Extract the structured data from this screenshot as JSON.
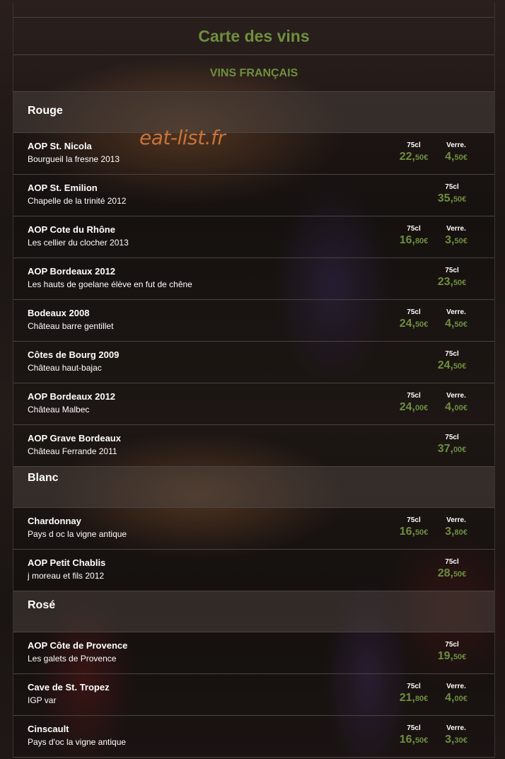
{
  "header": {
    "title": "Carte des vins",
    "subtitle": "VINS FRANÇAIS"
  },
  "watermark": "eat-list.fr",
  "labels": {
    "bottle": "75cl",
    "glass": "Verre."
  },
  "sections": [
    {
      "name": "Rouge",
      "wines": [
        {
          "name": "AOP St. Nicola",
          "desc": "Bourgueil la fresne 2013",
          "bottle_int": "22,",
          "bottle_cents": "50€",
          "glass_int": "4,",
          "glass_cents": "50€"
        },
        {
          "name": "AOP St. Emilion",
          "desc": "Chapelle de la trinité 2012",
          "bottle_int": "35,",
          "bottle_cents": "50€"
        },
        {
          "name": "AOP Cote du Rhône",
          "desc": "Les cellier du clocher 2013",
          "bottle_int": "16,",
          "bottle_cents": "80€",
          "glass_int": "3,",
          "glass_cents": "50€"
        },
        {
          "name": "AOP Bordeaux 2012",
          "desc": "Les hauts de goelane élève en fut de chêne",
          "bottle_int": "23,",
          "bottle_cents": "50€"
        },
        {
          "name": "Bodeaux 2008",
          "desc": "Château barre gentillet",
          "bottle_int": "24,",
          "bottle_cents": "50€",
          "glass_int": "4,",
          "glass_cents": "50€"
        },
        {
          "name": "Côtes de Bourg 2009",
          "desc": "Château haut-bajac",
          "bottle_int": "24,",
          "bottle_cents": "50€"
        },
        {
          "name": "AOP Bordeaux 2012",
          "desc": "Château Malbec",
          "bottle_int": "24,",
          "bottle_cents": "00€",
          "glass_int": "4,",
          "glass_cents": "00€"
        },
        {
          "name": "AOP Grave Bordeaux",
          "desc": "Château Ferrande 2011",
          "bottle_int": "37,",
          "bottle_cents": "00€"
        }
      ]
    },
    {
      "name": "Blanc",
      "wines": [
        {
          "name": "Chardonnay",
          "desc": "Pays d oc la vigne antique",
          "bottle_int": "16,",
          "bottle_cents": "50€",
          "glass_int": "3,",
          "glass_cents": "80€"
        },
        {
          "name": "AOP Petit Chablis",
          "desc": "j moreau et fils 2012",
          "bottle_int": "28,",
          "bottle_cents": "50€"
        }
      ]
    },
    {
      "name": "Rosé",
      "wines": [
        {
          "name": "AOP Côte de Provence",
          "desc": "Les galets de Provence",
          "bottle_int": "19,",
          "bottle_cents": "50€"
        },
        {
          "name": "Cave de St. Tropez",
          "desc": "IGP var",
          "bottle_int": "21,",
          "bottle_cents": "80€",
          "glass_int": "4,",
          "glass_cents": "00€"
        },
        {
          "name": "Cinscault",
          "desc": "Pays d'oc la vigne antique",
          "bottle_int": "16,",
          "bottle_cents": "50€",
          "glass_int": "3,",
          "glass_cents": "30€"
        }
      ]
    }
  ],
  "colors": {
    "accent": "#6e8f3f",
    "watermark": "#c8733a"
  }
}
